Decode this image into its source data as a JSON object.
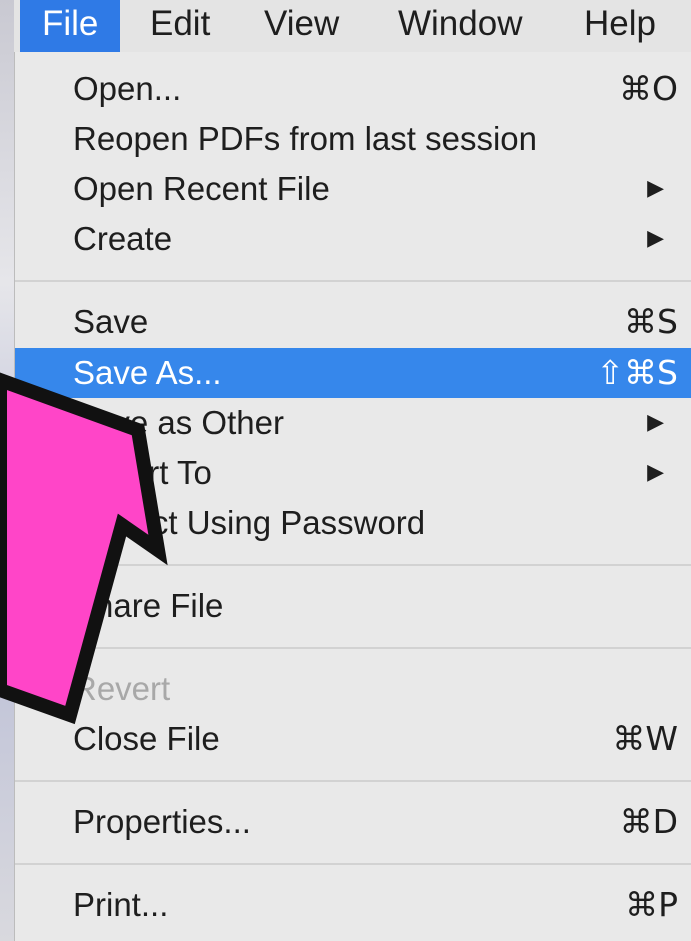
{
  "menubar": {
    "items": [
      {
        "label": "File",
        "active": true
      },
      {
        "label": "Edit"
      },
      {
        "label": "View"
      },
      {
        "label": "Window"
      },
      {
        "label": "Help"
      }
    ]
  },
  "file_menu": {
    "open": {
      "label": "Open...",
      "shortcut": "⌘O"
    },
    "reopen": {
      "label": "Reopen PDFs from last session"
    },
    "open_recent": {
      "label": "Open Recent File",
      "submenu": "▶"
    },
    "create": {
      "label": "Create",
      "submenu": "▶"
    },
    "save": {
      "label": "Save",
      "shortcut": "⌘S"
    },
    "save_as": {
      "label": "Save As...",
      "shortcut": "⇧⌘S"
    },
    "save_as_other": {
      "label": "Save as Other",
      "submenu": "▶"
    },
    "export_to": {
      "label": "Export To",
      "submenu": "▶"
    },
    "protect": {
      "label": "Protect Using Password"
    },
    "share": {
      "label": "Share File"
    },
    "revert": {
      "label": "Revert"
    },
    "close": {
      "label": "Close File",
      "shortcut": "⌘W"
    },
    "properties": {
      "label": "Properties...",
      "shortcut": "⌘D"
    },
    "print": {
      "label": "Print...",
      "shortcut": "⌘P"
    }
  },
  "annotation": {
    "arrow_color": "#ff45c8",
    "arrow_outline": "#111111"
  }
}
